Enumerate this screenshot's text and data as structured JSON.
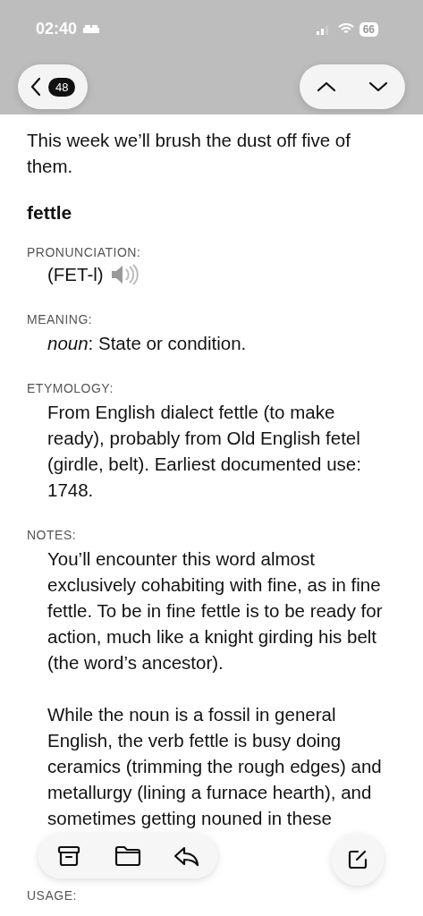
{
  "status_bar": {
    "time": "02:40",
    "battery": "66"
  },
  "nav": {
    "unread_count": "48"
  },
  "intro": "This week we’ll brush the dust off five of them.",
  "headword": "fettle",
  "sections": [
    {
      "kind": "pronunciation",
      "label": "PRONUNCIATION:",
      "text": "(FET-l)"
    },
    {
      "kind": "text",
      "label": "MEANING:",
      "text": "*noun*: State or condition."
    },
    {
      "kind": "text",
      "label": "ETYMOLOGY:",
      "text": "From English dialect fettle (to make ready), probably from Old English fetel (girdle, belt). Earliest documented use: 1748."
    },
    {
      "kind": "paragraphs",
      "label": "NOTES:",
      "paragraphs": [
        "You’ll encounter this word almost exclusively cohabiting with fine, as in fine fettle. To be in fine fettle is to be ready for action, much like a knight girding his belt (the word’s ancestor).",
        "While the noun is a fossil in general English, the verb fettle is busy doing ceramics (trimming the rough edges) and metallurgy (lining a furnace hearth), and sometimes getting nouned in these"
      ]
    },
    {
      "kind": "label",
      "label": "USAGE:"
    }
  ]
}
